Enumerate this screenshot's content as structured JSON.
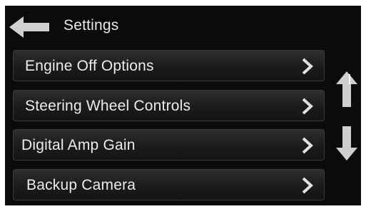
{
  "header": {
    "title": "Settings",
    "back_icon": "left-arrow-icon"
  },
  "menu": {
    "items": [
      {
        "label": "Engine Off Options",
        "icon": "chevron-right-icon"
      },
      {
        "label": "Steering Wheel Controls",
        "icon": "chevron-right-icon"
      },
      {
        "label": "Digital Amp Gain",
        "icon": "chevron-right-icon"
      },
      {
        "label": "Backup Camera",
        "icon": "chevron-right-icon"
      }
    ]
  },
  "scroll": {
    "up_icon": "up-arrow-icon",
    "down_icon": "down-arrow-icon"
  },
  "colors": {
    "background": "#0b0b0b",
    "text": "#ececec",
    "icon": "#d9d9d9"
  }
}
